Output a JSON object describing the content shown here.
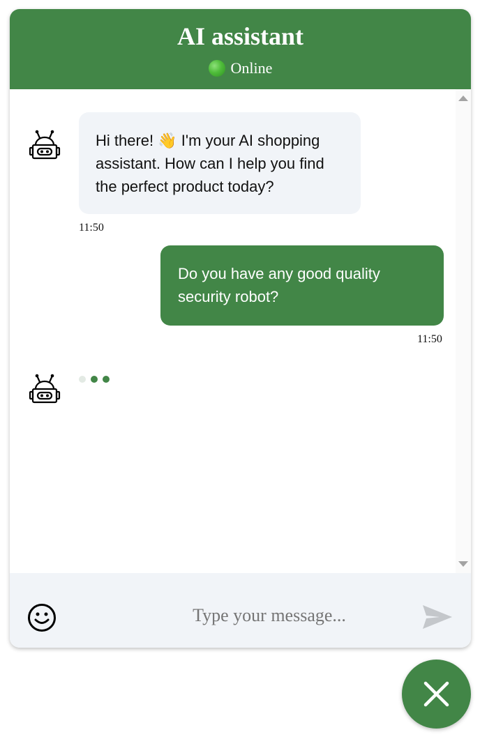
{
  "header": {
    "title": "AI assistant",
    "status_text": "Online",
    "status_color": "#4fbd3a",
    "background_color": "#428647"
  },
  "messages": [
    {
      "sender": "bot",
      "avatar_icon": "robot-icon",
      "text": "Hi there! 👋 I'm your AI shopping assistant. How can I help you find the perfect product today?",
      "time": "11:50"
    },
    {
      "sender": "user",
      "text": "Do you have any good quality security robot?",
      "time": "11:50"
    }
  ],
  "typing_indicator": {
    "avatar_icon": "robot-icon",
    "dot_count": 3
  },
  "composer": {
    "emoji_icon": "smiley-icon",
    "placeholder": "Type your message...",
    "value": "",
    "send_icon": "send-icon"
  },
  "close_button": {
    "icon": "close-icon"
  },
  "colors": {
    "accent": "#428647",
    "bot_bubble": "#f1f4f8",
    "input_bar": "#f1f4f8"
  }
}
